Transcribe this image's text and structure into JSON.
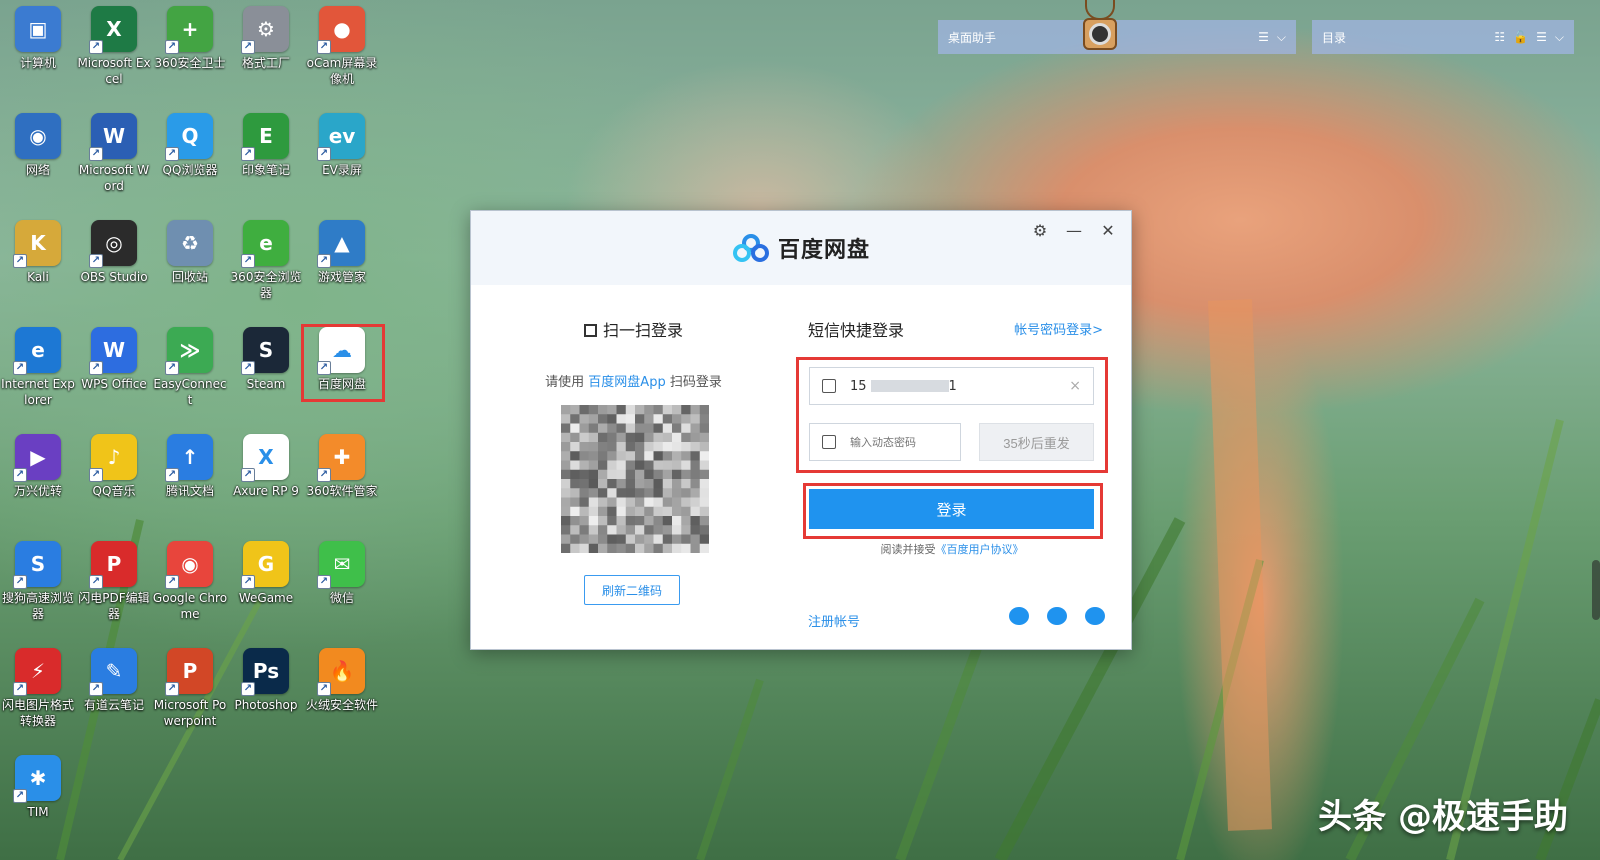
{
  "desktop": {
    "icons": [
      {
        "label": "计算机",
        "glyph": "▣",
        "color": "#3b7bd1"
      },
      {
        "label": "Microsoft Excel",
        "glyph": "X",
        "color": "#1e7a45"
      },
      {
        "label": "360安全卫士",
        "glyph": "+",
        "color": "#43a443"
      },
      {
        "label": "格式工厂",
        "glyph": "⚙",
        "color": "#8a8f98"
      },
      {
        "label": "oCam屏幕录像机",
        "glyph": "●",
        "color": "#e2563a"
      },
      {
        "label": "网络",
        "glyph": "◉",
        "color": "#2f6fc1"
      },
      {
        "label": "Microsoft Word",
        "glyph": "W",
        "color": "#2b5fb4"
      },
      {
        "label": "QQ浏览器",
        "glyph": "Q",
        "color": "#2a9be8"
      },
      {
        "label": "印象笔记",
        "glyph": "E",
        "color": "#2e9a3e"
      },
      {
        "label": "EV录屏",
        "glyph": "ev",
        "color": "#2aa6c9"
      },
      {
        "label": "Kali",
        "glyph": "K",
        "color": "#d6a93a"
      },
      {
        "label": "OBS Studio",
        "glyph": "◎",
        "color": "#2b2b2b"
      },
      {
        "label": "回收站",
        "glyph": "♻",
        "color": "#6f8fb0"
      },
      {
        "label": "360安全浏览器",
        "glyph": "e",
        "color": "#3fae3f"
      },
      {
        "label": "游戏管家",
        "glyph": "▲",
        "color": "#2f7cc7"
      },
      {
        "label": "Internet Explorer",
        "glyph": "e",
        "color": "#1d78d4"
      },
      {
        "label": "WPS Office",
        "glyph": "W",
        "color": "#2d6de0"
      },
      {
        "label": "EasyConnect",
        "glyph": "≫",
        "color": "#3caa53"
      },
      {
        "label": "Steam",
        "glyph": "S",
        "color": "#1b2838"
      },
      {
        "label": "百度网盘",
        "glyph": "☁",
        "color": "#ffffff"
      },
      {
        "label": "万兴优转",
        "glyph": "▶",
        "color": "#6a3fc2"
      },
      {
        "label": "QQ音乐",
        "glyph": "♪",
        "color": "#f0c419"
      },
      {
        "label": "腾讯文档",
        "glyph": "↑",
        "color": "#2a7de1"
      },
      {
        "label": "Axure RP 9",
        "glyph": "X",
        "color": "#ffffff"
      },
      {
        "label": "360软件管家",
        "glyph": "✚",
        "color": "#f38b2a"
      },
      {
        "label": "搜狗高速浏览器",
        "glyph": "S",
        "color": "#2a7de1"
      },
      {
        "label": "闪电PDF编辑器",
        "glyph": "P",
        "color": "#d92b2b"
      },
      {
        "label": "Google Chrome",
        "glyph": "◉",
        "color": "#e8453c"
      },
      {
        "label": "WeGame",
        "glyph": "G",
        "color": "#f0c419"
      },
      {
        "label": "微信",
        "glyph": "✉",
        "color": "#3fbf4a"
      },
      {
        "label": "闪电图片格式转换器",
        "glyph": "⚡",
        "color": "#d92b2b"
      },
      {
        "label": "有道云笔记",
        "glyph": "✎",
        "color": "#2a7de1"
      },
      {
        "label": "Microsoft Powerpoint",
        "glyph": "P",
        "color": "#d24726"
      },
      {
        "label": "Photoshop",
        "glyph": "Ps",
        "color": "#0a2a4a"
      },
      {
        "label": "火绒安全软件",
        "glyph": "🔥",
        "color": "#f28a1f"
      },
      {
        "label": "TIM",
        "glyph": "✱",
        "color": "#2a8fe8"
      }
    ]
  },
  "widgets": {
    "desktop_helper": {
      "title": "桌面助手",
      "btns": [
        "☰",
        "⌵"
      ]
    },
    "catalog": {
      "title": "目录",
      "btns": [
        "☷",
        "🔓",
        "☰",
        "⌵"
      ]
    }
  },
  "dialog": {
    "app_name": "百度网盘",
    "controls": {
      "settings": "⚙",
      "minimize": "—",
      "close": "✕"
    },
    "qr": {
      "title": "扫一扫登录",
      "hint_prefix": "请使用",
      "hint_app": "百度网盘App",
      "hint_suffix": "扫码登录",
      "refresh": "刷新二维码"
    },
    "sms": {
      "title": "短信快捷登录",
      "password_login_link": "帐号密码登录>",
      "phone_prefix": "15",
      "phone_suffix": "1",
      "clear": "×",
      "code_placeholder": "输入动态密码",
      "resend": "35秒后重发",
      "login": "登录",
      "agree_prefix": "阅读并接受",
      "agree_link": "《百度用户协议》",
      "register": "注册帐号"
    },
    "socials": [
      "wechat-icon",
      "weibo-icon",
      "qq-icon"
    ]
  },
  "watermark": "头条 @极速手助"
}
